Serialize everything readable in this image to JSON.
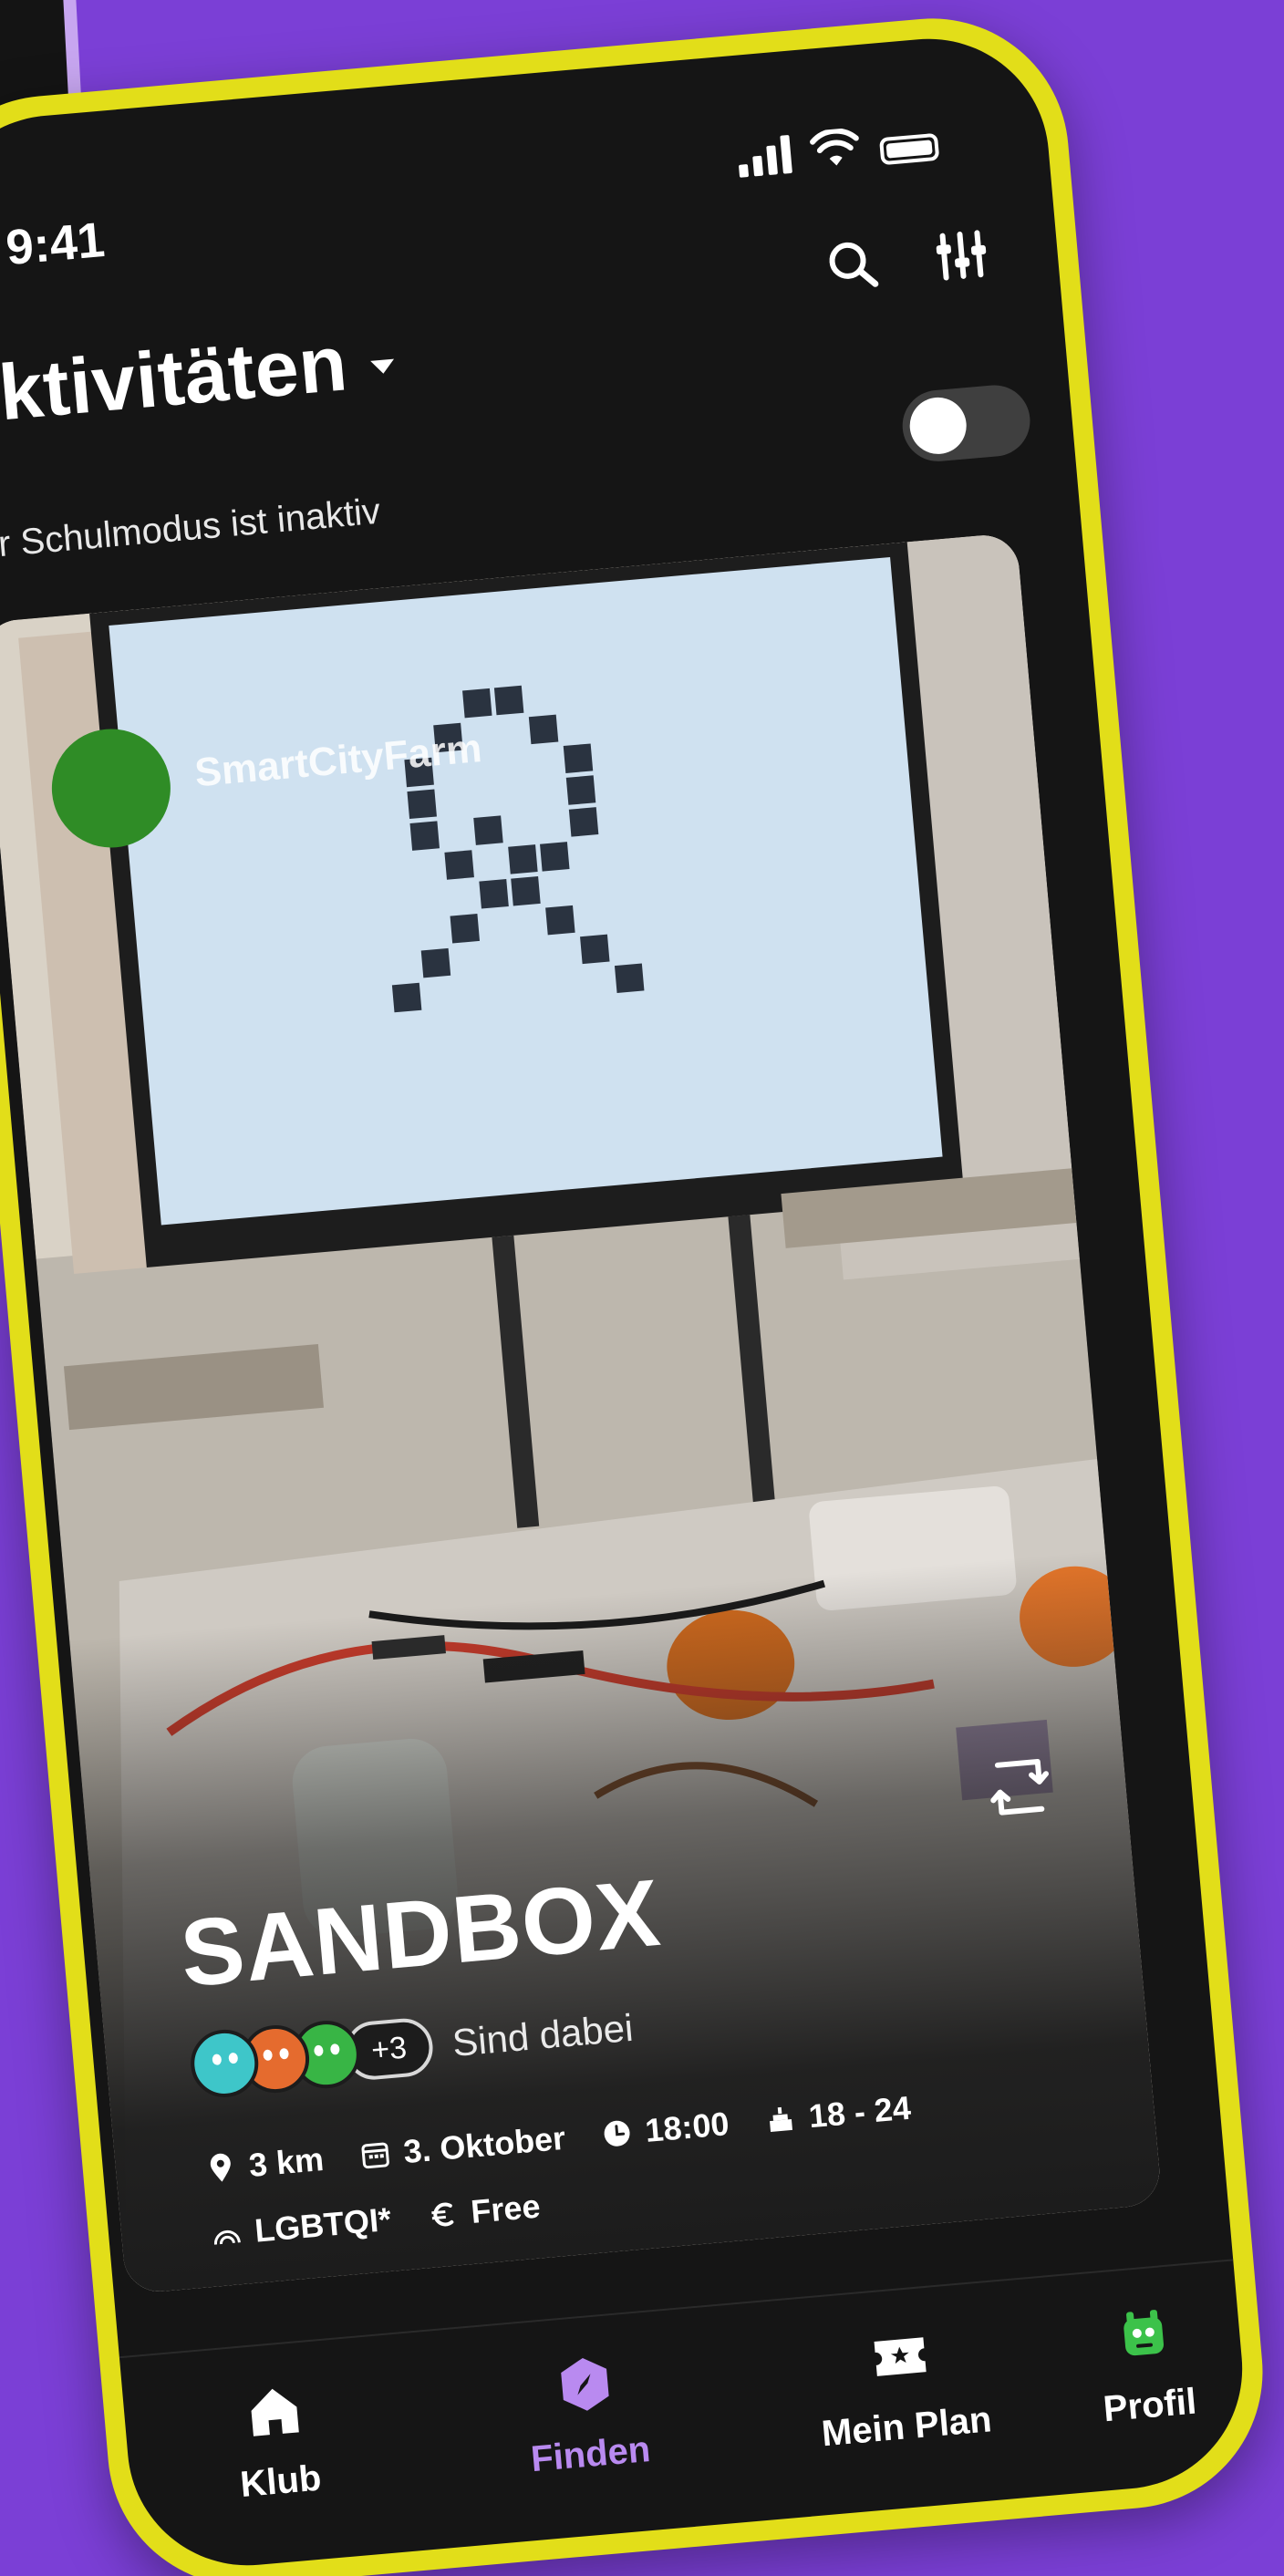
{
  "status_bar": {
    "time": "9:41"
  },
  "header": {
    "title": "Aktivitäten",
    "school_mode_text": "Der Schulmodus ist inaktiv",
    "school_mode_enabled": false
  },
  "card": {
    "organizer": "SmartCityFarm",
    "title": "SANDBOX",
    "attendees_more": "+3",
    "attendees_label": "Sind dabei",
    "distance": "3 km",
    "date": "3. Oktober",
    "time": "18:00",
    "age": "18 - 24",
    "tag": "LGBTQI*",
    "price": "Free"
  },
  "tabs": [
    {
      "label": "Klub",
      "icon": "home-icon",
      "active": false
    },
    {
      "label": "Finden",
      "icon": "compass-icon",
      "active": true
    },
    {
      "label": "Mein Plan",
      "icon": "ticket-icon",
      "active": false
    },
    {
      "label": "Profil",
      "icon": "monster-avatar-icon",
      "active": false
    }
  ],
  "colors": {
    "background": "#7b3fd6",
    "phone_frame": "#e2de19",
    "screen": "#151515",
    "active_tab": "#b98af0",
    "organizer_avatar": "#2f8c26"
  }
}
